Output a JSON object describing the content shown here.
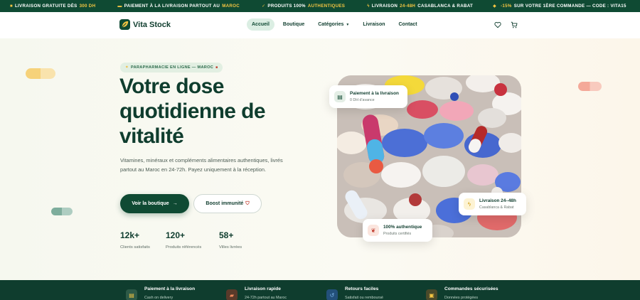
{
  "ticker": {
    "items": [
      {
        "icon": "truck-icon",
        "text": "LIVRAISON GRATUITE DÈS",
        "highlight": "300 DH",
        "after": ""
      },
      {
        "icon": "cash-icon",
        "text": "PAIEMENT À LA LIVRAISON PARTOUT AU",
        "highlight": "MAROC",
        "after": ""
      },
      {
        "icon": "check-icon",
        "text": "PRODUITS 100%",
        "highlight": "AUTHENTIQUES",
        "after": ""
      },
      {
        "icon": "bolt-icon",
        "text": "LIVRAISON",
        "highlight": "24-48H",
        "after": "CASABLANCA & RABAT"
      },
      {
        "icon": "gift-icon",
        "text": "",
        "highlight": "-15%",
        "after": "SUR VOTRE 1ÈRE COMMANDE — CODE : VITA15"
      }
    ]
  },
  "header": {
    "brand_part1": "Vita",
    "brand_part2": "Stock",
    "nav": {
      "home": "Accueil",
      "shop": "Boutique",
      "categories": "Catégories",
      "delivery": "Livraison",
      "contact": "Contact"
    }
  },
  "hero": {
    "badge": "PARAPHARMACIE EN LIGNE — MAROC",
    "title_line1": "Votre dose",
    "title_line2": "quotidienne de",
    "title_line3": "vitalité",
    "lead": "Vitamines, minéraux et compléments alimentaires authentiques, livrés partout au Maroc en 24-72h. Payez uniquement à la réception.",
    "cta_primary": "Voir la boutique",
    "cta_secondary": "Boost immunité",
    "stats": [
      {
        "value": "12k+",
        "label": "Clients satisfaits"
      },
      {
        "value": "120+",
        "label": "Produits référencés"
      },
      {
        "value": "58+",
        "label": "Villes livrées"
      }
    ],
    "cards": {
      "payment_title": "Paiement à la livraison",
      "payment_sub": "0 DH d'avance",
      "delivery_title": "Livraison 24–48h",
      "delivery_sub": "Casablanca & Rabat",
      "auth_title": "100% authentique",
      "auth_sub": "Produits certifiés"
    }
  },
  "features": [
    {
      "title": "Paiement à la livraison",
      "sub": "Cash on delivery"
    },
    {
      "title": "Livraison rapide",
      "sub": "24-72h partout au Maroc"
    },
    {
      "title": "Retours faciles",
      "sub": "Satisfait ou remboursé"
    },
    {
      "title": "Commandes sécurisées",
      "sub": "Données protégées"
    }
  ],
  "colors": {
    "brand_green": "#0f4a33",
    "accent_yellow": "#f4c542",
    "soft_green": "#dbeee3"
  }
}
